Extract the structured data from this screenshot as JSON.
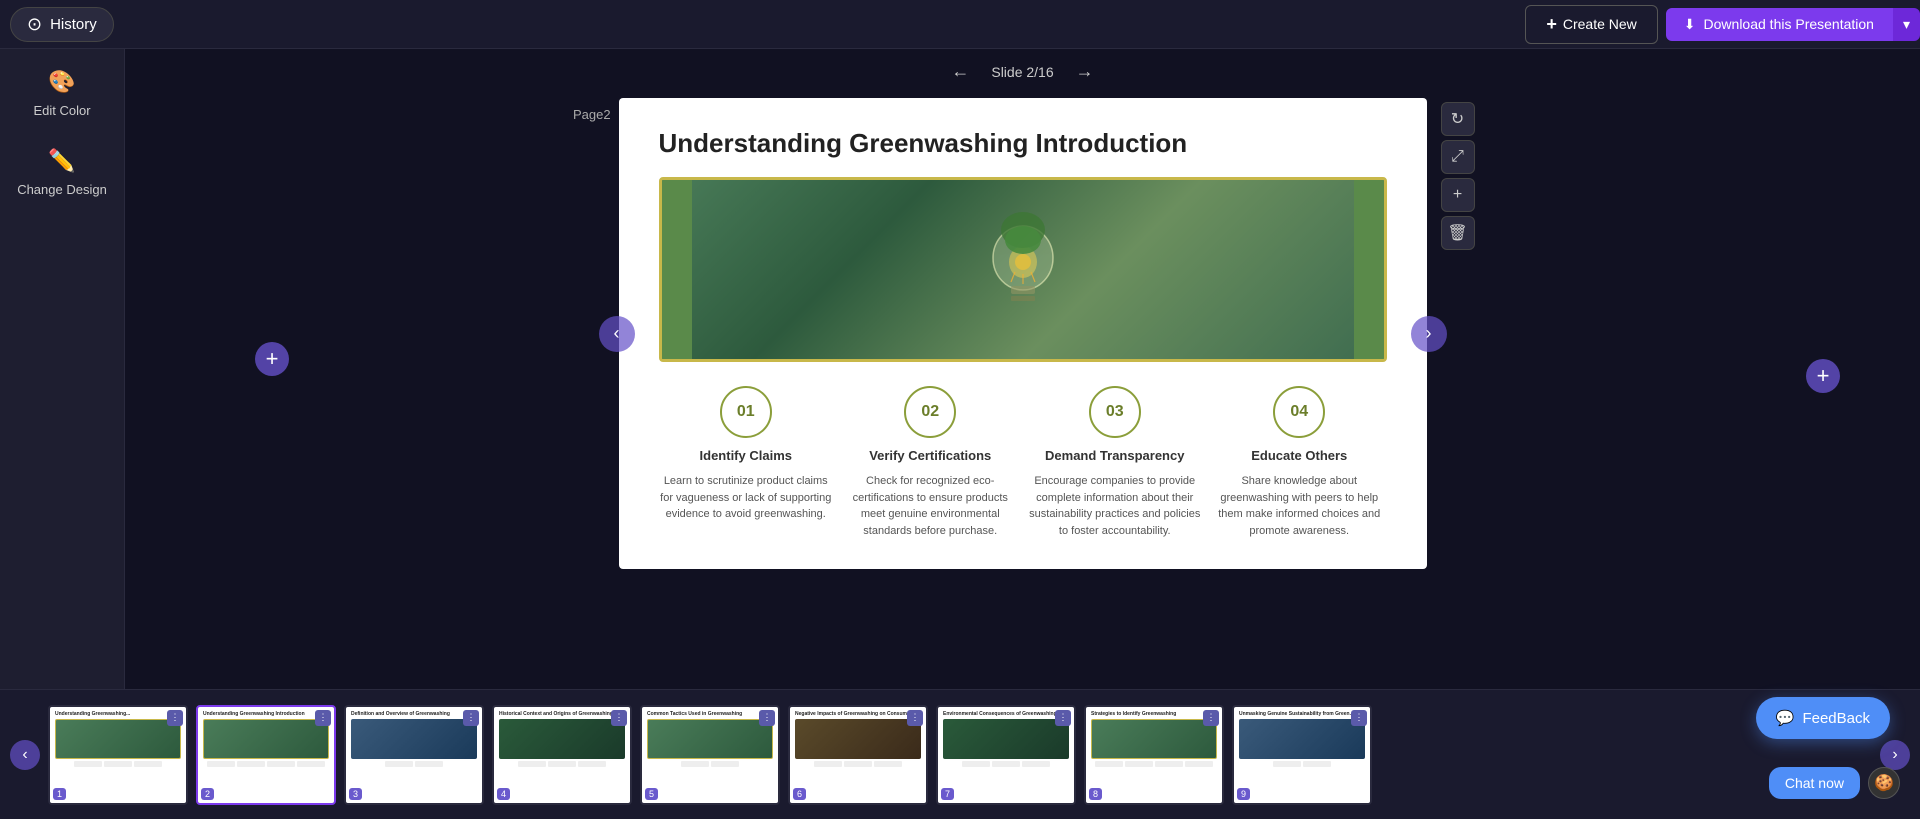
{
  "topbar": {
    "history_label": "History",
    "create_new_label": "Create New",
    "download_label": "Download this Presentation",
    "download_arrow": "▾"
  },
  "sidebar": {
    "edit_color_label": "Edit Color",
    "change_design_label": "Change Design"
  },
  "slide_nav": {
    "slide_info": "Slide 2/16",
    "page_label": "Page2",
    "prev_arrow": "←",
    "next_arrow": "→"
  },
  "slide": {
    "title": "Understanding Greenwashing Introduction",
    "points": [
      {
        "number": "01",
        "title": "Identify Claims",
        "desc": "Learn to scrutinize product claims for vagueness or lack of supporting evidence to avoid greenwashing."
      },
      {
        "number": "02",
        "title": "Verify Certifications",
        "desc": "Check for recognized eco-certifications to ensure products meet genuine environmental standards before purchase."
      },
      {
        "number": "03",
        "title": "Demand Transparency",
        "desc": "Encourage companies to provide complete information about their sustainability practices and policies to foster accountability."
      },
      {
        "number": "04",
        "title": "Educate Others",
        "desc": "Share knowledge about greenwashing with peers to help them make informed choices and promote awareness."
      }
    ]
  },
  "tools": {
    "refresh_icon": "↻",
    "resize_icon": "⤢",
    "plus_icon": "+",
    "delete_icon": "🗑"
  },
  "bottom_strip": {
    "prev_arrow": "‹",
    "next_arrow": "›",
    "thumbnails": [
      {
        "num": "1",
        "type": "green",
        "title": "Understanding Greenwashing..."
      },
      {
        "num": "2",
        "type": "green",
        "title": "Understanding Greenwashing Introduction"
      },
      {
        "num": "3",
        "type": "blue",
        "title": "Definition and Overview of Greenwashing"
      },
      {
        "num": "4",
        "type": "forest",
        "title": "Historical Context and Origins of Greenwashing"
      },
      {
        "num": "5",
        "type": "green",
        "title": "Common Tactics Used in Greenwashing"
      },
      {
        "num": "6",
        "type": "brown",
        "title": "Negative Impacts of Greenwashing on Consumers"
      },
      {
        "num": "7",
        "type": "forest",
        "title": "Environmental Consequences of Greenwashing"
      },
      {
        "num": "8",
        "type": "green",
        "title": "Strategies to Identify Greenwashing"
      },
      {
        "num": "9",
        "type": "blue",
        "title": "Unmasking Genuine Sustainability from Green..."
      }
    ]
  },
  "feedback": {
    "label": "FeedBack",
    "chat_label": "Chat now"
  },
  "add_left_label": "+",
  "add_right_label": "+"
}
